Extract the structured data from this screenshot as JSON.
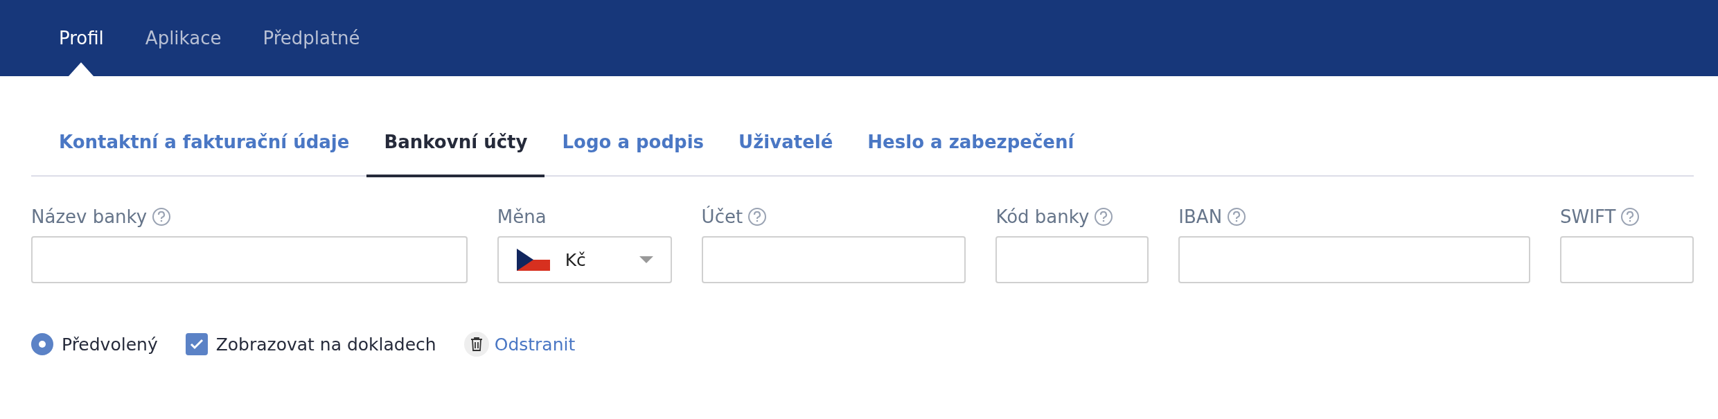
{
  "top_tabs": [
    {
      "label": "Profil",
      "selected": true
    },
    {
      "label": "Aplikace",
      "selected": false
    },
    {
      "label": "Předplatné",
      "selected": false
    }
  ],
  "sub_tabs": [
    {
      "label": "Kontaktní a fakturační údaje",
      "selected": false
    },
    {
      "label": "Bankovní účty",
      "selected": true
    },
    {
      "label": "Logo a podpis",
      "selected": false
    },
    {
      "label": "Uživatelé",
      "selected": false
    },
    {
      "label": "Heslo a zabezpečení",
      "selected": false
    }
  ],
  "fields": [
    {
      "kind": "text",
      "label": "Název banky",
      "help": true
    },
    {
      "kind": "select",
      "label": "Měna",
      "help": false,
      "value": "Kč"
    },
    {
      "kind": "text",
      "label": "Účet",
      "help": true
    },
    {
      "kind": "text",
      "label": "Kód banky",
      "help": true
    },
    {
      "kind": "text",
      "label": "IBAN",
      "help": true
    },
    {
      "kind": "text",
      "label": "SWIFT",
      "help": true
    }
  ],
  "options": {
    "default": {
      "label": "Předvolený",
      "selected": true
    },
    "show_on_documents": {
      "label": "Zobrazovat na dokladech",
      "checked": true
    },
    "remove": {
      "label": "Odstranit"
    }
  }
}
